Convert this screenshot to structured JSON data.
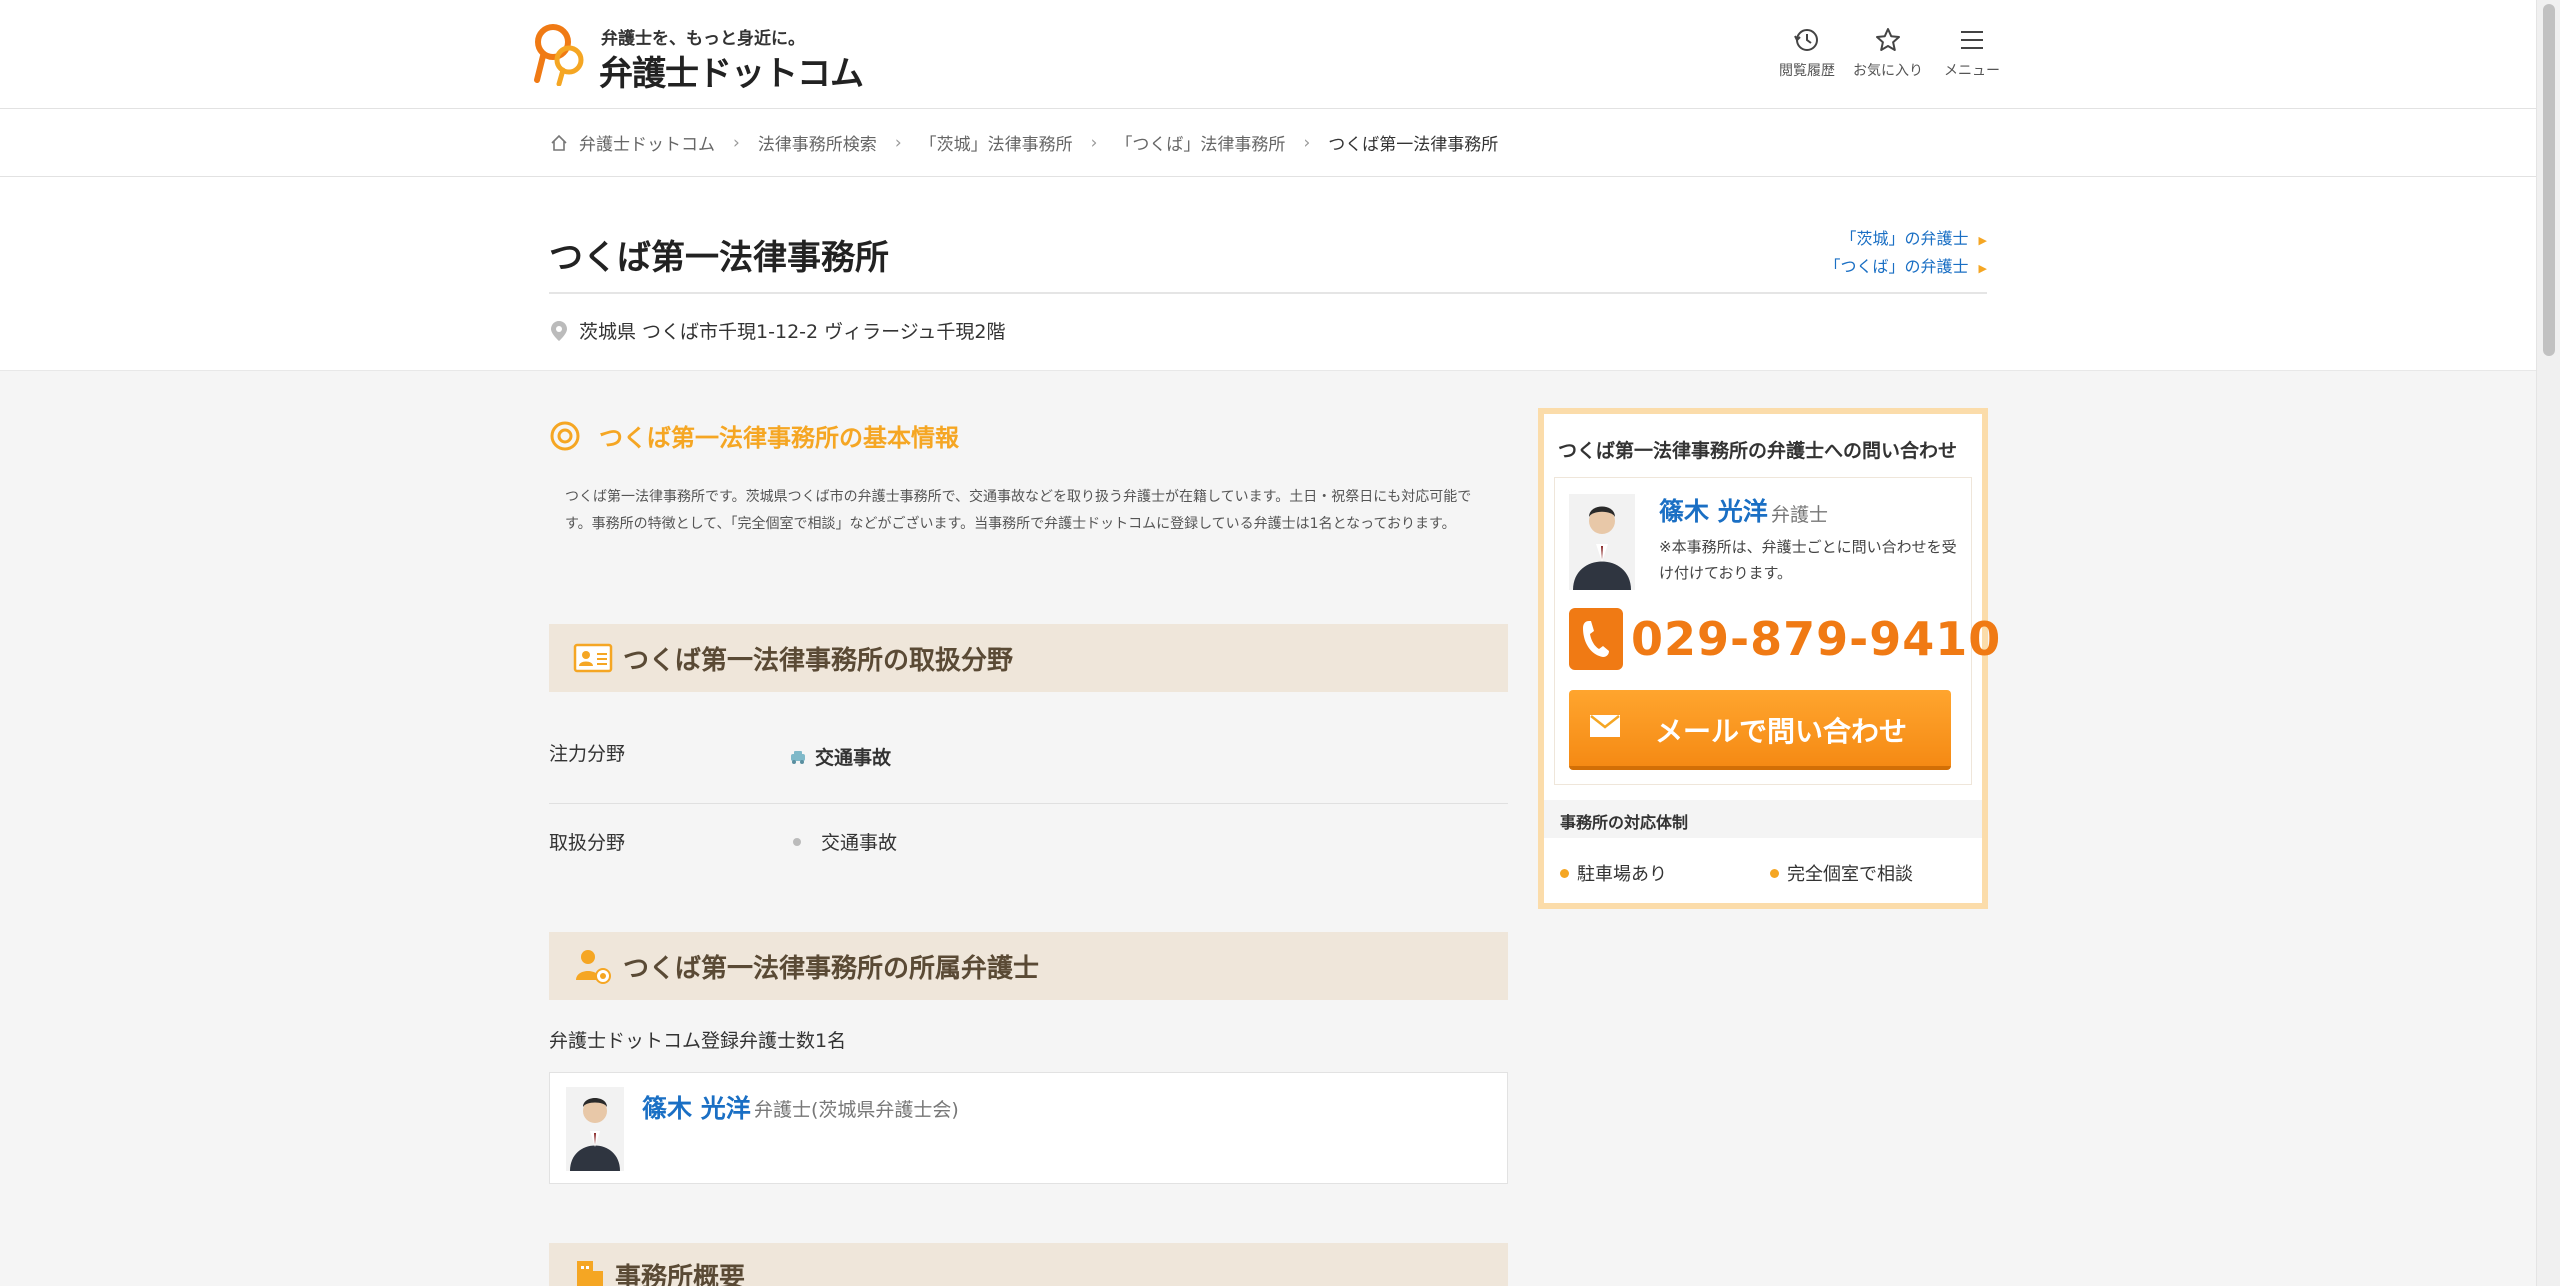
{
  "header": {
    "tagline": "弁護士を、もっと身近に。",
    "brand": "弁護士ドットコム",
    "nav": {
      "history": "閲覧履歴",
      "favorites": "お気に入り",
      "menu": "メニュー"
    }
  },
  "breadcrumb": {
    "home": "弁護士ドットコム",
    "items": [
      "法律事務所検索",
      "「茨城」法律事務所",
      "「つくば」法律事務所"
    ],
    "current": "つくば第一法律事務所"
  },
  "office": {
    "name": "つくば第一法律事務所",
    "address": "茨城県 つくば市千現1-12-2 ヴィラージュ千現2階",
    "links": [
      "「茨城」の弁護士",
      "「つくば」の弁護士"
    ]
  },
  "basic_info": {
    "title": "つくば第一法律事務所の基本情報",
    "text": "つくば第一法律事務所です。茨城県つくば市の弁護士事務所で、交通事故などを取り扱う弁護士が在籍しています。土日・祝祭日にも対応可能です。事務所の特徴として、「完全個室で相談」などがございます。当事務所で弁護士ドットコムに登録している弁護士は1名となっております。"
  },
  "fields": {
    "title": "つくば第一法律事務所の取扱分野",
    "focus_label": "注力分野",
    "focus_value": "交通事故",
    "handled_label": "取扱分野",
    "handled_value": "交通事故"
  },
  "lawyers": {
    "title": "つくば第一法律事務所の所属弁護士",
    "count_text": "弁護士ドットコム登録弁護士数1名",
    "items": [
      {
        "name": "篠木 光洋",
        "role": "弁護士(茨城県弁護士会)"
      }
    ]
  },
  "overview": {
    "title": "事務所概要"
  },
  "sidebar": {
    "title": "つくば第一法律事務所の弁護士への問い合わせ",
    "lawyer_name": "篠木 光洋",
    "lawyer_role": "弁護士",
    "note": "※本事務所は、弁護士ごとに問い合わせを受け付けております。",
    "phone": "029-879-9410",
    "mail_button": "メールで問い合わせ",
    "support_title": "事務所の対応体制",
    "features": [
      "駐車場あり",
      "完全個室で相談"
    ]
  },
  "colors": {
    "accent": "#f5a623",
    "phone": "#f07a14",
    "link": "#1a6fc4",
    "band": "#efe6da"
  }
}
